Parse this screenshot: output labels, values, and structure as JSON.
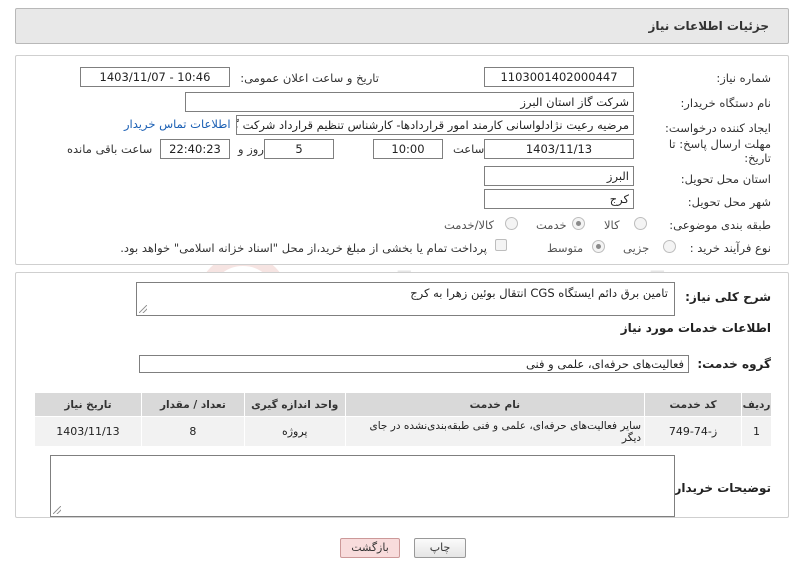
{
  "header": {
    "title": "جزئیات اطلاعات نیاز"
  },
  "form": {
    "need_number_label": "شماره نیاز:",
    "need_number": "1103001402000447",
    "announce_label": "تاریخ و ساعت اعلان عمومی:",
    "announce_value": "1403/11/07 - 10:46",
    "buyer_org_label": "نام دستگاه خریدار:",
    "buyer_org": "شرکت گاز استان البرز",
    "creator_label": "ایجاد کننده درخواست:",
    "creator": "مرضیه رعیت نژادلواسانی کارمند امور قراردادها- کارشناس تنظیم قرارداد شرکت گاز استان البرز",
    "contact_link": "اطلاعات تماس خریدار",
    "deadline_label_1": "مهلت ارسال پاسخ: تا",
    "deadline_label_2": "تاریخ:",
    "deadline_date": "1403/11/13",
    "time_label": "ساعت",
    "deadline_time": "10:00",
    "days_value": "5",
    "days_label": "روز و",
    "remaining_time": "22:40:23",
    "remaining_label": "ساعت باقی مانده",
    "province_label": "استان محل تحویل:",
    "province": "البرز",
    "city_label": "شهر محل تحویل:",
    "city": "کرج",
    "category_label": "طبقه بندی موضوعی:",
    "category_options": [
      "کالا",
      "خدمت",
      "کالا/خدمت"
    ],
    "process_label": "نوع فرآیند خرید :",
    "process_options": [
      "جزیی",
      "متوسط"
    ],
    "payment_note": "پرداخت تمام یا بخشی از مبلغ خرید،از محل \"اسناد خزانه اسلامی\" خواهد بود."
  },
  "details": {
    "summary_label": "شرح کلی نیاز:",
    "summary": "تامین برق دائم ایستگاه CGS انتقال بوئین زهرا به کرج",
    "services_heading": "اطلاعات خدمات مورد نیاز",
    "service_group_label": "گروه خدمت:",
    "service_group": "فعالیت‌های حرفه‌ای، علمی و فنی",
    "table": {
      "headers": [
        "ردیف",
        "کد خدمت",
        "نام خدمت",
        "واحد اندازه گیری",
        "تعداد / مقدار",
        "تاریخ نیاز"
      ],
      "rows": [
        [
          "1",
          "ز-74-749",
          "سایر فعالیت‌های حرفه‌ای، علمی و فنی طبقه‌بندی‌نشده در جای دیگر",
          "پروژه",
          "8",
          "1403/11/13"
        ]
      ]
    },
    "buyer_notes_label": "توضیحات خریدار:",
    "buyer_notes": ""
  },
  "buttons": {
    "print": "چاپ",
    "back": "بازگشت"
  },
  "watermark": {
    "text": "AriaTender.neT"
  }
}
